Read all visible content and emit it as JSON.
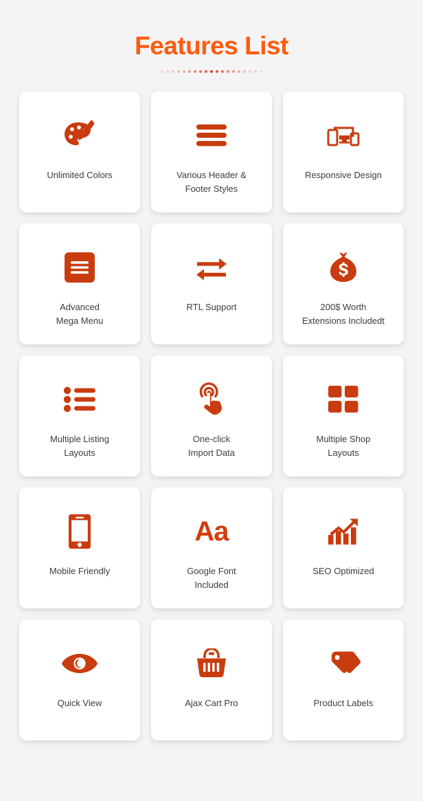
{
  "header": {
    "title": "Features List",
    "divider_dot_count": 19,
    "divider_dot_color": "#e03b1c",
    "title_color": "#FF5A0E"
  },
  "theme": {
    "background": "#f4f4f4",
    "card_background": "#ffffff",
    "icon_color": "#c93c0f",
    "label_color": "#3c3c3c"
  },
  "features": [
    {
      "icon": "palette-icon",
      "label": "Unlimited Colors"
    },
    {
      "icon": "menu-bars-icon",
      "label": "Various Header &\nFooter Styles"
    },
    {
      "icon": "responsive-devices-icon",
      "label": "Responsive Design"
    },
    {
      "icon": "mega-menu-icon",
      "label": "Advanced\nMega Menu"
    },
    {
      "icon": "exchange-arrows-icon",
      "label": "RTL Support"
    },
    {
      "icon": "money-bag-icon",
      "label": "200$ Worth\nExtensions Includedt"
    },
    {
      "icon": "bullet-list-icon",
      "label": "Multiple Listing\nLayouts"
    },
    {
      "icon": "click-hand-icon",
      "label": "One-click\nImport Data"
    },
    {
      "icon": "grid-squares-icon",
      "label": "Multiple Shop\nLayouts"
    },
    {
      "icon": "mobile-phone-icon",
      "label": "Mobile Friendly"
    },
    {
      "icon": "typography-aa-icon",
      "label": "Google Font\nIncluded"
    },
    {
      "icon": "growth-chart-icon",
      "label": "SEO Optimized"
    },
    {
      "icon": "eye-icon",
      "label": "Quick View"
    },
    {
      "icon": "shopping-basket-icon",
      "label": "Ajax Cart Pro"
    },
    {
      "icon": "price-tags-icon",
      "label": "Product Labels"
    }
  ]
}
